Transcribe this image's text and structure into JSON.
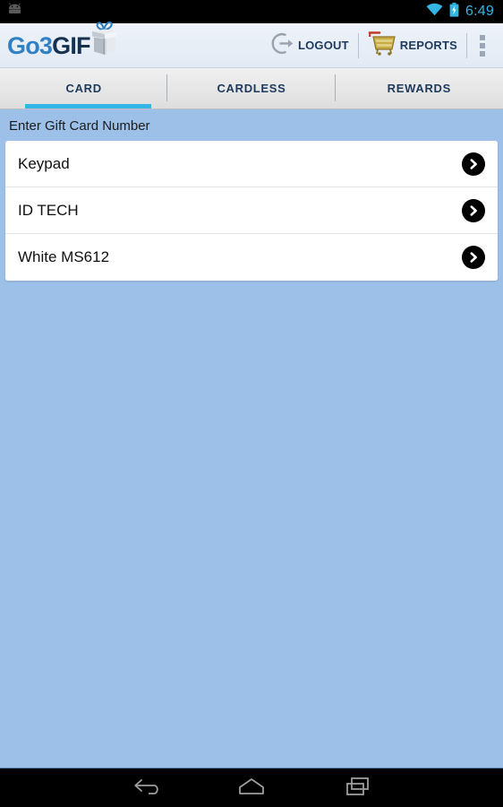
{
  "status_bar": {
    "notification_icon": "android-robot-icon",
    "wifi_icon": "wifi-icon",
    "battery_icon": "battery-charging-icon",
    "time": "6:49",
    "time_color": "#33b5e5"
  },
  "header": {
    "logo": {
      "text_primary": "Go3",
      "text_secondary": "GIF",
      "primary_color": "#2f80c4",
      "secondary_color": "#15314f",
      "gift_icon": "gift-box-icon"
    },
    "actions": [
      {
        "id": "logout",
        "label": "LOGOUT",
        "icon": "logout-circle-arrow-icon"
      },
      {
        "id": "reports",
        "label": "REPORTS",
        "icon": "shopping-cart-icon"
      }
    ],
    "overflow_icon": "overflow-menu-icon"
  },
  "tabs": {
    "active_index": 0,
    "indicator_color": "#33b5e5",
    "items": [
      {
        "label": "CARD"
      },
      {
        "label": "CARDLESS"
      },
      {
        "label": "REWARDS"
      }
    ]
  },
  "content": {
    "section_label": "Enter Gift Card Number",
    "background_color": "#9cc0e8",
    "list_items": [
      {
        "label": "Keypad",
        "chevron_icon": "chevron-right-circle-icon"
      },
      {
        "label": "ID TECH",
        "chevron_icon": "chevron-right-circle-icon"
      },
      {
        "label": "White MS612",
        "chevron_icon": "chevron-right-circle-icon"
      }
    ]
  },
  "navigation_bar": {
    "buttons": [
      {
        "id": "back",
        "icon": "back-arrow-icon"
      },
      {
        "id": "home",
        "icon": "home-icon"
      },
      {
        "id": "recents",
        "icon": "recent-apps-icon"
      }
    ]
  }
}
